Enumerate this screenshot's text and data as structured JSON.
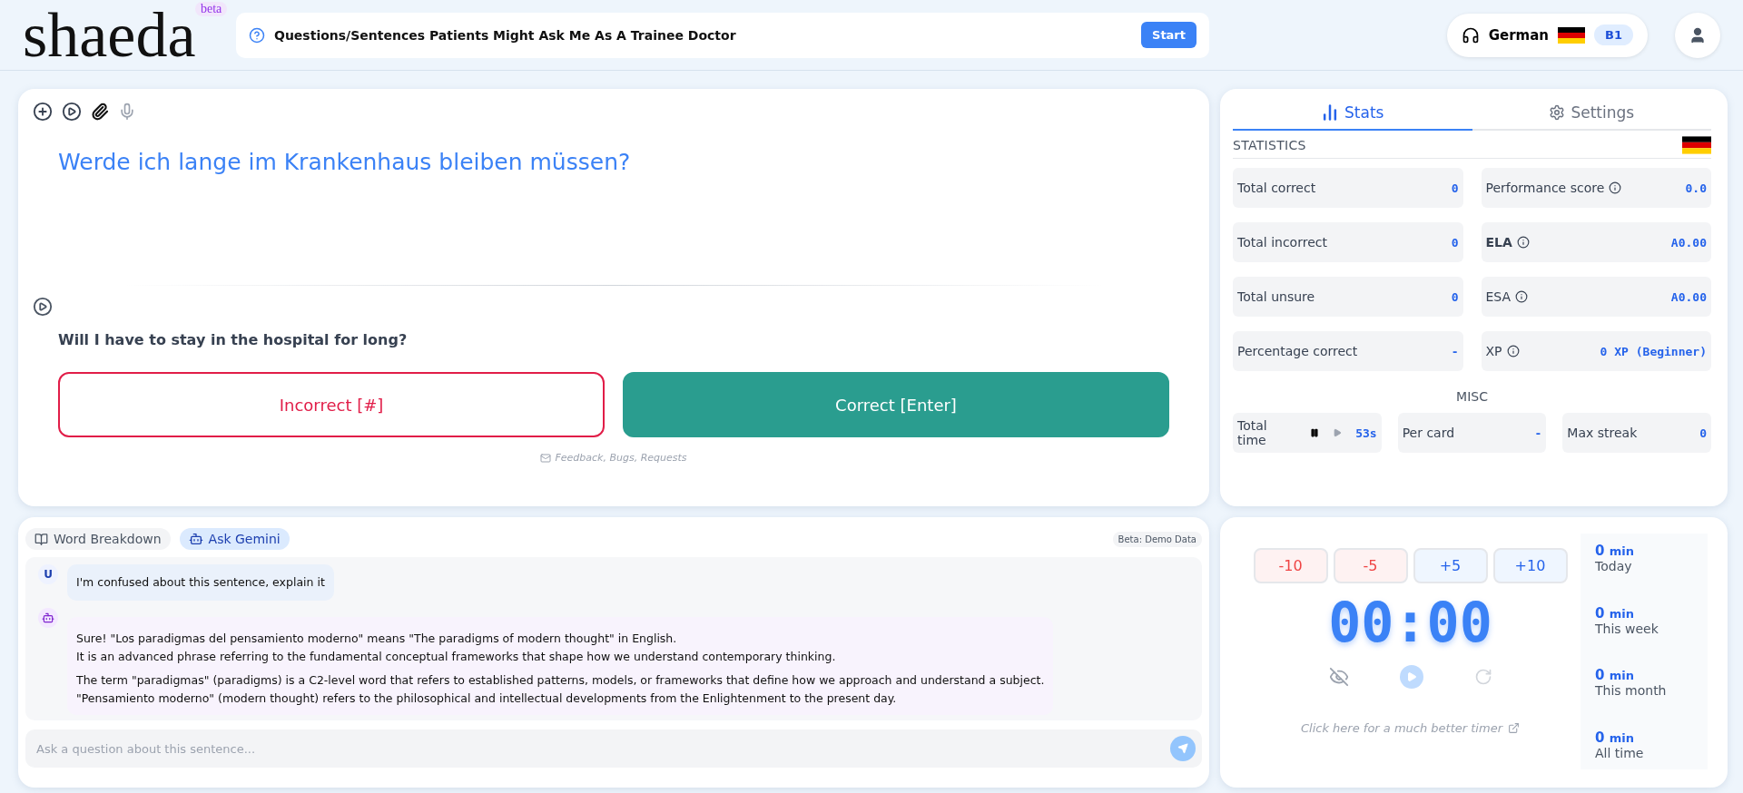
{
  "header": {
    "logo": "shaeda",
    "logo_badge": "beta",
    "deck": {
      "title": "Questions/Sentences Patients Might Ask Me As A Trainee Doctor",
      "button": "Start"
    },
    "language": {
      "name": "German",
      "level": "B1"
    }
  },
  "card": {
    "mic_disabled": true,
    "prompt": "Werde ich lange im Krankenhaus bleiben müssen?",
    "translation": "Will I have to stay in the hospital for long?",
    "answers": [
      {
        "kind": "incorrect",
        "label": "Incorrect [#]"
      },
      {
        "kind": "correct",
        "label": "Correct [Enter]"
      }
    ],
    "feedback_link": "Feedback, Bugs, Requests"
  },
  "stats_panel": {
    "tabs": [
      {
        "kind": "stats",
        "label": "Stats",
        "selected": true
      },
      {
        "kind": "settings",
        "label": "Settings",
        "selected": false
      }
    ],
    "statistics_heading": "STATISTICS",
    "statistics": [
      {
        "label": "Total correct",
        "value": "0",
        "info": false,
        "bold": false
      },
      {
        "label": "Performance score",
        "value": "0.0",
        "info": true,
        "bold": false
      },
      {
        "label": "Total incorrect",
        "value": "0",
        "info": false,
        "bold": false
      },
      {
        "label": "ELA",
        "value": "A0.00",
        "info": true,
        "bold": true
      },
      {
        "label": "Total unsure",
        "value": "0",
        "info": false,
        "bold": false
      },
      {
        "label": "ESA",
        "value": "A0.00",
        "info": true,
        "bold": false
      },
      {
        "label": "Percentage correct",
        "value": "-",
        "info": false,
        "bold": false
      },
      {
        "label": "XP",
        "value": "0 XP (Beginner)",
        "info": true,
        "bold": false
      }
    ],
    "misc_heading": "MISC",
    "misc": [
      {
        "kind": "timer",
        "label": "Total time",
        "value": "53s"
      },
      {
        "kind": "plain",
        "label": "Per card",
        "value": "-"
      },
      {
        "kind": "plain",
        "label": "Max streak",
        "value": "0"
      }
    ]
  },
  "assistant_panel": {
    "tabs": [
      {
        "kind": "book",
        "label": "Word Breakdown",
        "selected": false
      },
      {
        "kind": "robot",
        "label": "Ask Gemini",
        "selected": true
      }
    ],
    "badge": "Beta: Demo Data",
    "messages": [
      {
        "kind": "user",
        "avatar": "U",
        "paragraphs": [
          "I'm confused about this sentence, explain it"
        ]
      },
      {
        "kind": "assistant",
        "paragraphs": [
          "Sure! \"Los paradigmas del pensamiento moderno\" means \"The paradigms of modern thought\" in English.\nIt is an advanced phrase referring to the fundamental conceptual frameworks that shape how we understand contemporary thinking.",
          "The term \"paradigmas\" (paradigms) is a C2-level word that refers to established patterns, models, or frameworks that define how we approach and understand a subject.\n\"Pensamiento moderno\" (modern thought) refers to the philosophical and intellectual developments from the Enlightenment to the present day."
        ]
      }
    ],
    "input": {
      "placeholder": "Ask a question about this sentence..."
    }
  },
  "timer_panel": {
    "adjust": [
      {
        "kind": "minus",
        "label": "-10"
      },
      {
        "kind": "minus",
        "label": "-5"
      },
      {
        "kind": "plus",
        "label": "+5"
      },
      {
        "kind": "plus",
        "label": "+10"
      }
    ],
    "display": "00:00",
    "hidden": true,
    "link": "Click here for a much better timer",
    "totals": [
      {
        "value": "0",
        "unit": "min",
        "label": "Today"
      },
      {
        "value": "0",
        "unit": "min",
        "label": "This week"
      },
      {
        "value": "0",
        "unit": "min",
        "label": "This month"
      },
      {
        "value": "0",
        "unit": "min",
        "label": "All time"
      }
    ]
  }
}
